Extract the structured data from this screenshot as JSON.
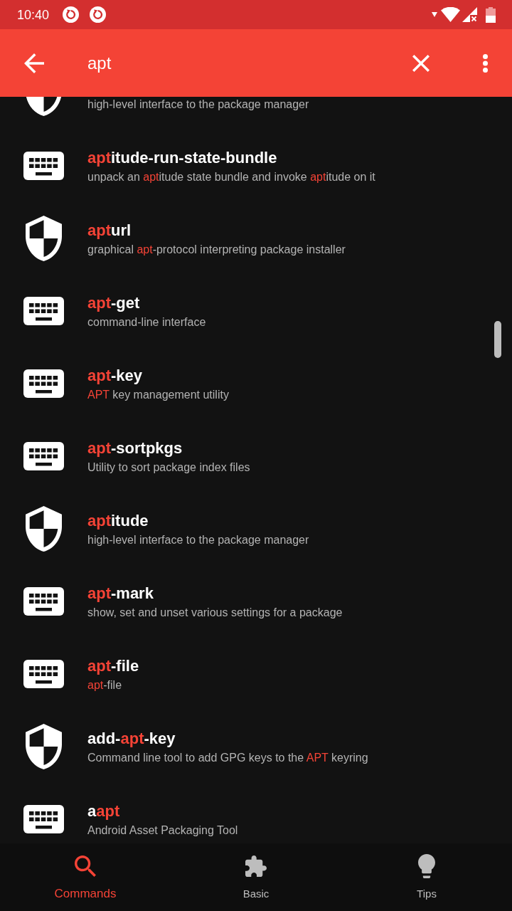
{
  "status_bar": {
    "time": "10:40"
  },
  "search_bar": {
    "query": "apt"
  },
  "commands": [
    {
      "kind": "shield",
      "description": [
        {
          "text": "high-level interface to the package manager",
          "highlighted": false
        }
      ]
    },
    {
      "kind": "keyboard",
      "name": [
        {
          "text": "apt",
          "highlighted": true
        },
        {
          "text": "itude-run-state-bundle",
          "highlighted": false
        }
      ],
      "description": [
        {
          "text": "unpack an ",
          "highlighted": false
        },
        {
          "text": "apt",
          "highlighted": true
        },
        {
          "text": "itude state bundle and invoke ",
          "highlighted": false
        },
        {
          "text": "apt",
          "highlighted": true
        },
        {
          "text": "itude on it",
          "highlighted": false
        }
      ]
    },
    {
      "kind": "shield",
      "name": [
        {
          "text": "apt",
          "highlighted": true
        },
        {
          "text": "url",
          "highlighted": false
        }
      ],
      "description": [
        {
          "text": "graphical ",
          "highlighted": false
        },
        {
          "text": "apt",
          "highlighted": true
        },
        {
          "text": "-protocol interpreting package installer",
          "highlighted": false
        }
      ]
    },
    {
      "kind": "keyboard",
      "name": [
        {
          "text": "apt",
          "highlighted": true
        },
        {
          "text": "-get",
          "highlighted": false
        }
      ],
      "description": [
        {
          "text": "command-line interface",
          "highlighted": false
        }
      ]
    },
    {
      "kind": "keyboard",
      "name": [
        {
          "text": "apt",
          "highlighted": true
        },
        {
          "text": "-key",
          "highlighted": false
        }
      ],
      "description": [
        {
          "text": "APT",
          "highlighted": true
        },
        {
          "text": " key management utility",
          "highlighted": false
        }
      ]
    },
    {
      "kind": "keyboard",
      "name": [
        {
          "text": "apt",
          "highlighted": true
        },
        {
          "text": "-sortpkgs",
          "highlighted": false
        }
      ],
      "description": [
        {
          "text": "Utility to sort package index files",
          "highlighted": false
        }
      ]
    },
    {
      "kind": "shield",
      "name": [
        {
          "text": "apt",
          "highlighted": true
        },
        {
          "text": "itude",
          "highlighted": false
        }
      ],
      "description": [
        {
          "text": "high-level interface to the package manager",
          "highlighted": false
        }
      ]
    },
    {
      "kind": "keyboard",
      "name": [
        {
          "text": "apt",
          "highlighted": true
        },
        {
          "text": "-mark",
          "highlighted": false
        }
      ],
      "description": [
        {
          "text": "show, set and unset various settings for a package",
          "highlighted": false
        }
      ]
    },
    {
      "kind": "keyboard",
      "name": [
        {
          "text": "apt",
          "highlighted": true
        },
        {
          "text": "-file",
          "highlighted": false
        }
      ],
      "description": [
        {
          "text": "apt",
          "highlighted": true
        },
        {
          "text": "-file",
          "highlighted": false
        }
      ]
    },
    {
      "kind": "shield",
      "name": [
        {
          "text": "add-",
          "highlighted": false
        },
        {
          "text": "apt",
          "highlighted": true
        },
        {
          "text": "-key",
          "highlighted": false
        }
      ],
      "description": [
        {
          "text": "Command line tool to add GPG keys to the ",
          "highlighted": false
        },
        {
          "text": "APT",
          "highlighted": true
        },
        {
          "text": " keyring",
          "highlighted": false
        }
      ]
    },
    {
      "kind": "keyboard",
      "name": [
        {
          "text": "a",
          "highlighted": false
        },
        {
          "text": "apt",
          "highlighted": true
        }
      ],
      "description": [
        {
          "text": "Android Asset Packaging Tool",
          "highlighted": false
        }
      ]
    }
  ],
  "bottom_nav": [
    {
      "label": "Commands",
      "selected": true
    },
    {
      "label": "Basic",
      "selected": false
    },
    {
      "label": "Tips",
      "selected": false
    }
  ]
}
